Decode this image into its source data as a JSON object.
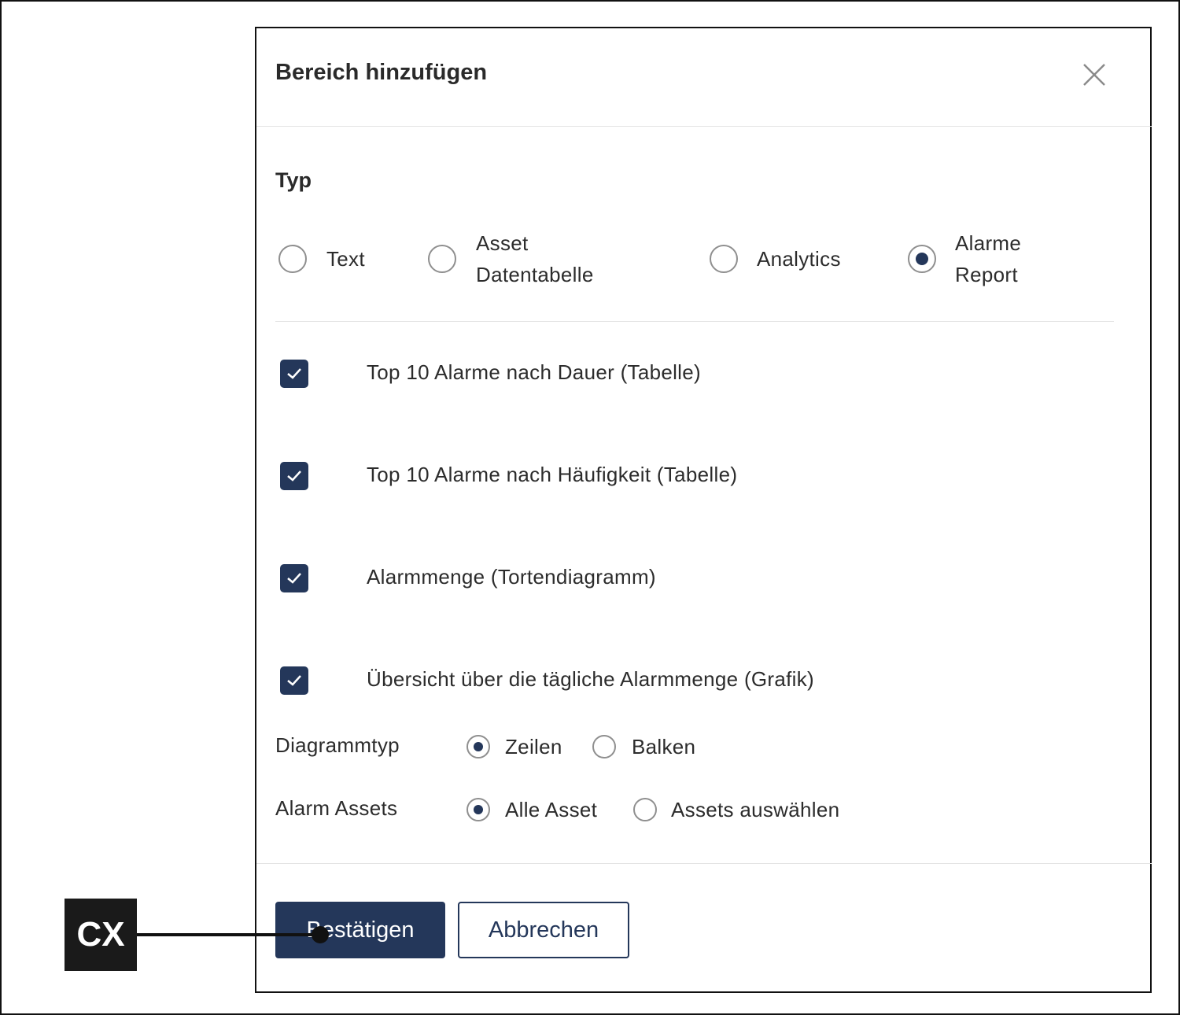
{
  "dialog": {
    "title": "Bereich hinzufügen",
    "type_section_label": "Typ",
    "type_options": [
      {
        "label": "Text",
        "selected": false
      },
      {
        "label": "Asset\nDatentabelle",
        "selected": false
      },
      {
        "label": "Analytics",
        "selected": false
      },
      {
        "label": "Alarme\nReport",
        "selected": true
      }
    ],
    "report_options": [
      {
        "label": "Top 10 Alarme nach Dauer (Tabelle)",
        "checked": true
      },
      {
        "label": "Top 10 Alarme nach Häufigkeit (Tabelle)",
        "checked": true
      },
      {
        "label": "Alarmmenge (Tortendiagramm)",
        "checked": true
      },
      {
        "label": "Übersicht über die tägliche Alarmmenge (Grafik)",
        "checked": true
      }
    ],
    "chart_type": {
      "label": "Diagrammtyp",
      "options": [
        {
          "label": "Zeilen",
          "selected": true
        },
        {
          "label": "Balken",
          "selected": false
        }
      ]
    },
    "alarm_assets": {
      "label": "Alarm Assets",
      "options": [
        {
          "label": "Alle Asset",
          "selected": true
        },
        {
          "label": "Assets auswählen",
          "selected": false
        }
      ]
    },
    "confirm_label": "Bestätigen",
    "cancel_label": "Abbrechen"
  },
  "callout": {
    "label": "CX"
  },
  "colors": {
    "primary": "#24375a",
    "border": "#8f8f8f",
    "divider": "#e3e3e3"
  },
  "icons": {
    "close": "close-icon",
    "check": "checkmark-icon"
  }
}
